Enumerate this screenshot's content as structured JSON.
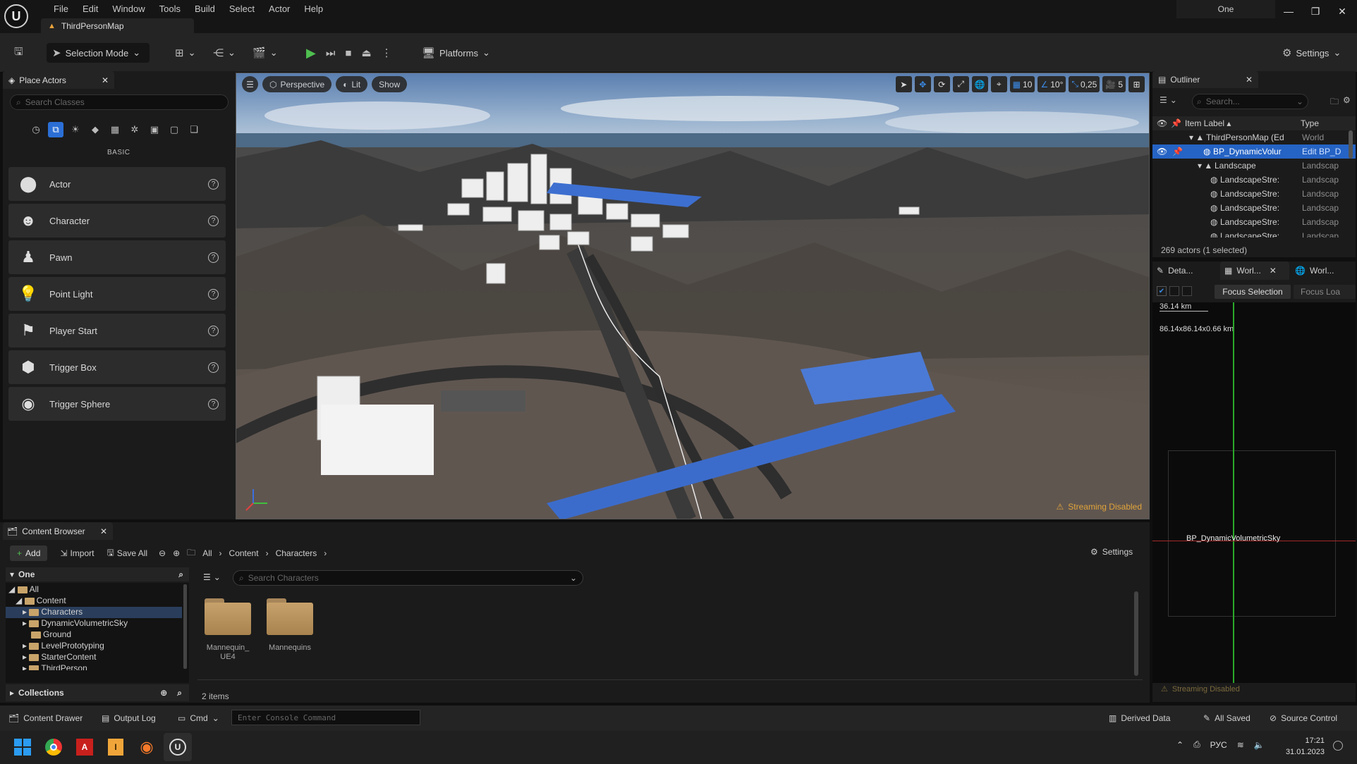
{
  "titlebar": {
    "menu": [
      "File",
      "Edit",
      "Window",
      "Tools",
      "Build",
      "Select",
      "Actor",
      "Help"
    ],
    "map_tab": "ThirdPersonMap",
    "project_name": "One"
  },
  "toolbar": {
    "selection_mode": "Selection Mode",
    "platforms": "Platforms",
    "settings": "Settings"
  },
  "place_actors": {
    "tab_title": "Place Actors",
    "search_placeholder": "Search Classes",
    "category_label": "BASIC",
    "items": [
      {
        "label": "Actor",
        "icon": "sphere-icon"
      },
      {
        "label": "Character",
        "icon": "character-icon"
      },
      {
        "label": "Pawn",
        "icon": "pawn-icon"
      },
      {
        "label": "Point Light",
        "icon": "point-light-icon"
      },
      {
        "label": "Player Start",
        "icon": "player-start-icon"
      },
      {
        "label": "Trigger Box",
        "icon": "trigger-box-icon"
      },
      {
        "label": "Trigger Sphere",
        "icon": "trigger-sphere-icon"
      }
    ]
  },
  "viewport": {
    "perspective": "Perspective",
    "lit": "Lit",
    "show": "Show",
    "grid_snap": "10",
    "rotation_snap": "10°",
    "scale_snap": "0,25",
    "camera_speed": "5",
    "streaming_status": "Streaming Disabled"
  },
  "outliner": {
    "tab_title": "Outliner",
    "search_placeholder": "Search...",
    "col_label": "Item Label",
    "col_type": "Type",
    "rows": [
      {
        "label": "ThirdPersonMap (Ed",
        "type": "World"
      },
      {
        "label": "BP_DynamicVolur",
        "type": "Edit BP_D"
      },
      {
        "label": "Landscape",
        "type": "Landscap"
      },
      {
        "label": "LandscapeStre:",
        "type": "Landscap"
      },
      {
        "label": "LandscapeStre:",
        "type": "Landscap"
      },
      {
        "label": "LandscapeStre:",
        "type": "Landscap"
      },
      {
        "label": "LandscapeStre:",
        "type": "Landscap"
      },
      {
        "label": "LandscapeStre:",
        "type": "Landscap"
      }
    ],
    "count": "269 actors (1 selected)"
  },
  "details": {
    "tabs": [
      "Deta...",
      "Worl...",
      "Worl..."
    ],
    "focus_selection": "Focus Selection",
    "focus_loaded": "Focus Loa",
    "scale_text": "36.14 km",
    "dimensions": "86.14x86.14x0.66 km",
    "actor_label": "BP_DynamicVolumetricSky",
    "streaming_status": "Streaming Disabled"
  },
  "content_browser": {
    "tab_title": "Content Browser",
    "add": "Add",
    "import": "Import",
    "save_all": "Save All",
    "breadcrumb": [
      "All",
      "Content",
      "Characters"
    ],
    "settings": "Settings",
    "root": "One",
    "tree": [
      {
        "label": "All",
        "indent": 0
      },
      {
        "label": "Content",
        "indent": 1
      },
      {
        "label": "Characters",
        "indent": 2
      },
      {
        "label": "DynamicVolumetricSky",
        "indent": 2
      },
      {
        "label": "Ground",
        "indent": 2
      },
      {
        "label": "LevelPrototyping",
        "indent": 2
      },
      {
        "label": "StarterContent",
        "indent": 2
      },
      {
        "label": "ThirdPerson",
        "indent": 2
      }
    ],
    "collections": "Collections",
    "search_placeholder": "Search Characters",
    "assets": [
      "Mannequin_UE4",
      "Mannequins"
    ],
    "item_count": "2 items"
  },
  "statusbar": {
    "content_drawer": "Content Drawer",
    "output_log": "Output Log",
    "cmd": "Cmd",
    "console_placeholder": "Enter Console Command",
    "derived_data": "Derived Data",
    "all_saved": "All Saved",
    "source_control": "Source Control"
  },
  "taskbar": {
    "lang": "РУС",
    "time": "17:21",
    "date": "31.01.2023"
  }
}
